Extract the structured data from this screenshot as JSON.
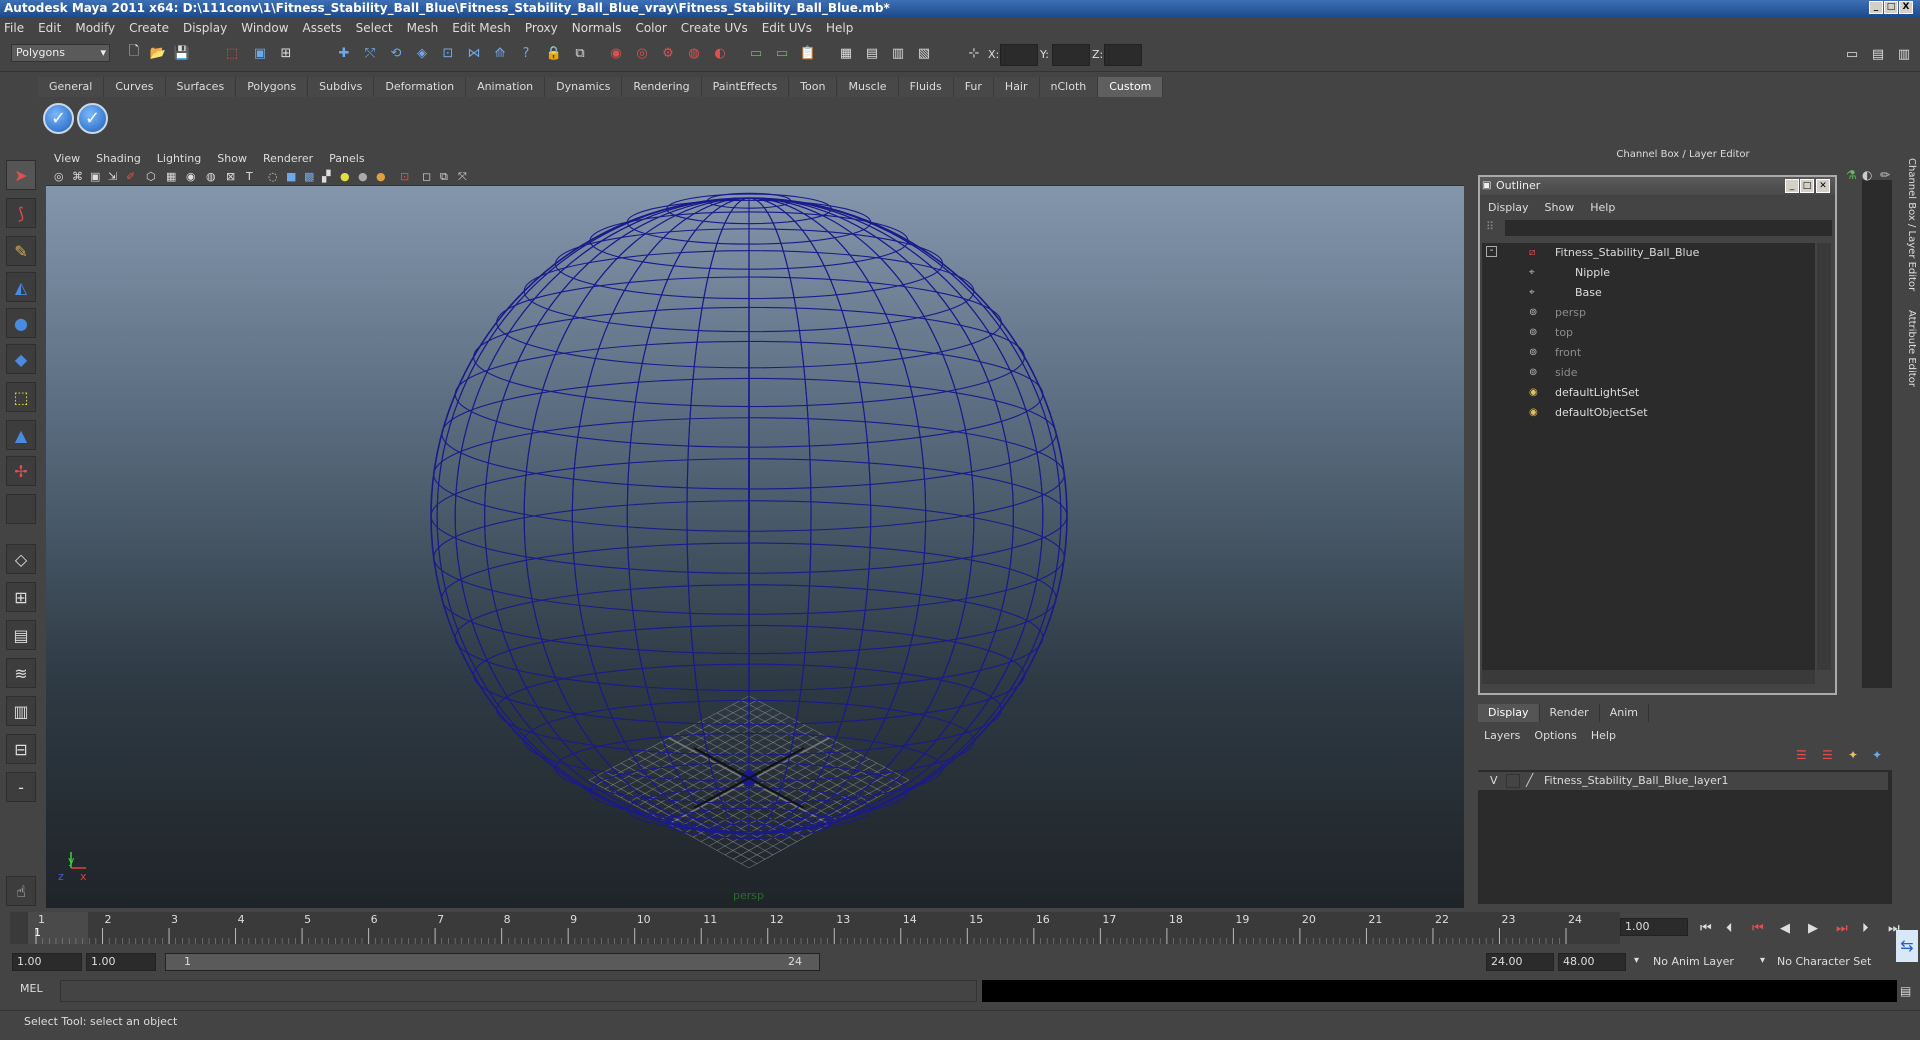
{
  "window": {
    "title": "Autodesk Maya 2011 x64: D:\\111conv\\1\\Fitness_Stability_Ball_Blue\\Fitness_Stability_Ball_Blue_vray\\Fitness_Stability_Ball_Blue.mb*",
    "min_label": "_",
    "max_label": "□",
    "close_label": "X"
  },
  "menubar": [
    "File",
    "Edit",
    "Modify",
    "Create",
    "Display",
    "Window",
    "Assets",
    "Select",
    "Mesh",
    "Edit Mesh",
    "Proxy",
    "Normals",
    "Color",
    "Create UVs",
    "Edit UVs",
    "Help"
  ],
  "statusline": {
    "mode": "Polygons",
    "x_label": "X:",
    "y_label": "Y:",
    "z_label": "Z:"
  },
  "shelf": {
    "tabs": [
      "General",
      "Curves",
      "Surfaces",
      "Polygons",
      "Subdivs",
      "Deformation",
      "Animation",
      "Dynamics",
      "Rendering",
      "PaintEffects",
      "Toon",
      "Muscle",
      "Fluids",
      "Fur",
      "Hair",
      "nCloth",
      "Custom"
    ],
    "active_tab": "Custom"
  },
  "viewport": {
    "menu": [
      "View",
      "Shading",
      "Lighting",
      "Show",
      "Renderer",
      "Panels"
    ],
    "camera_label": "persp",
    "axis_y": "y",
    "axis_x": "x",
    "axis_z": "z",
    "wire_color": "#1a1a8c"
  },
  "channel_box": {
    "header": "Channel Box / Layer Editor"
  },
  "outliner": {
    "title": "Outliner",
    "menu": [
      "Display",
      "Show",
      "Help"
    ],
    "items": [
      {
        "label": "Fitness_Stability_Ball_Blue",
        "dim": false
      },
      {
        "label": "Nipple",
        "dim": false
      },
      {
        "label": "Base",
        "dim": false
      },
      {
        "label": "persp",
        "dim": true
      },
      {
        "label": "top",
        "dim": true
      },
      {
        "label": "front",
        "dim": true
      },
      {
        "label": "side",
        "dim": true
      },
      {
        "label": "defaultLightSet",
        "dim": false
      },
      {
        "label": "defaultObjectSet",
        "dim": false
      }
    ]
  },
  "layer_editor": {
    "tabs": [
      "Display",
      "Render",
      "Anim"
    ],
    "active_tab": "Display",
    "menu": [
      "Layers",
      "Options",
      "Help"
    ],
    "layer_visibility": "V",
    "layer_name": "Fitness_Stability_Ball_Blue_layer1"
  },
  "side_tabs": [
    "Channel Box / Layer Editor",
    "Attribute Editor"
  ],
  "timeline": {
    "ticks": [
      "1",
      "2",
      "3",
      "4",
      "5",
      "6",
      "7",
      "8",
      "9",
      "10",
      "11",
      "12",
      "13",
      "14",
      "15",
      "16",
      "17",
      "18",
      "19",
      "20",
      "21",
      "22",
      "23",
      "24"
    ],
    "current_marker": "1",
    "current_frame": "1.00"
  },
  "range": {
    "start": "1.00",
    "playback_start": "1.00",
    "slider_start": "1",
    "slider_end": "24",
    "playback_end": "24.00",
    "end": "48.00",
    "anim_layer": "No Anim Layer",
    "character_set": "No Character Set"
  },
  "command_line": {
    "label": "MEL"
  },
  "help_line": {
    "text": "Select Tool: select an object"
  }
}
